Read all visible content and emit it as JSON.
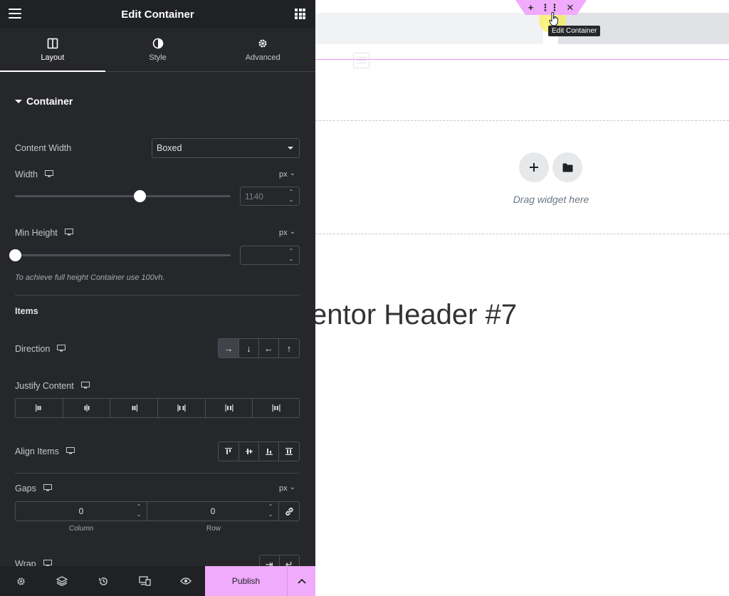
{
  "panel": {
    "title": "Edit Container",
    "tabs": [
      {
        "label": "Layout",
        "icon": "layout-icon",
        "active": true
      },
      {
        "label": "Style",
        "icon": "style-icon",
        "active": false
      },
      {
        "label": "Advanced",
        "icon": "gear-icon",
        "active": false
      }
    ],
    "section_title": "Container",
    "content_width": {
      "label": "Content Width",
      "value": "Boxed"
    },
    "width": {
      "label": "Width",
      "unit": "px",
      "value": "1140",
      "slider_fraction": 0.58
    },
    "min_height": {
      "label": "Min Height",
      "unit": "px",
      "value": "",
      "slider_fraction": 0.0
    },
    "hint": "To achieve full height Container use 100vh.",
    "items_title": "Items",
    "direction": {
      "label": "Direction",
      "options": [
        "→",
        "↓",
        "←",
        "↑"
      ],
      "selected": 0
    },
    "justify_content": {
      "label": "Justify Content"
    },
    "align_items": {
      "label": "Align Items"
    },
    "gaps": {
      "label": "Gaps",
      "unit": "px",
      "column": "0",
      "row": "0",
      "column_label": "Column",
      "row_label": "Row"
    },
    "wrap": {
      "label": "Wrap"
    }
  },
  "footer": {
    "publish_label": "Publish",
    "icons": [
      "gear-icon",
      "layers-icon",
      "history-icon",
      "responsive-icon",
      "eye-icon"
    ]
  },
  "canvas": {
    "handle_buttons": [
      "+",
      "⋮⋮",
      "✕"
    ],
    "tooltip": "Edit Container",
    "drop_text": "Drag widget here",
    "heading": "entor Header #7"
  },
  "colors": {
    "panel_bg": "#26272b",
    "panel_header_bg": "#1f2124",
    "accent_pink": "#f0abfc",
    "canvas_bg": "#ffffff"
  }
}
